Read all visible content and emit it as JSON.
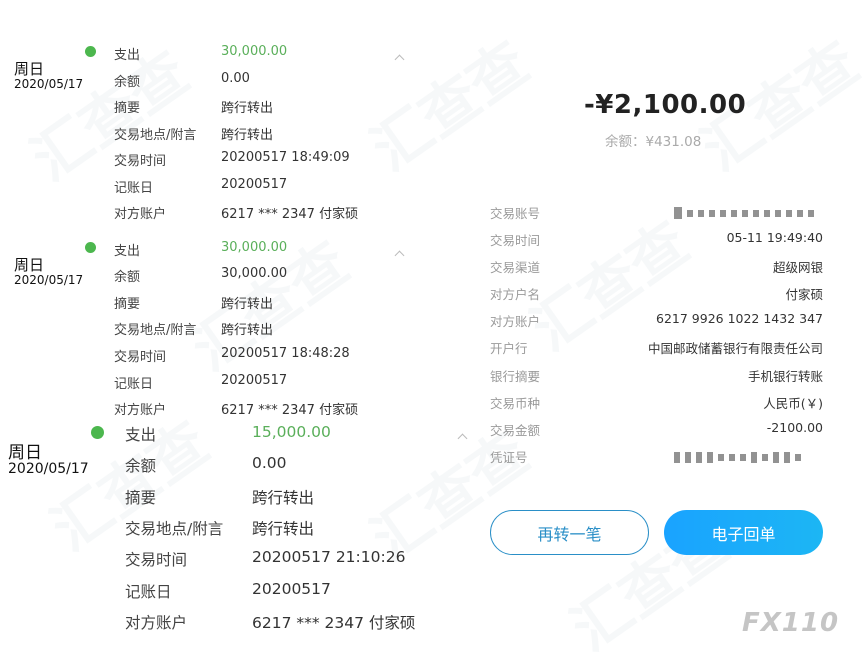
{
  "watermark": "汇查查",
  "left": {
    "records": [
      {
        "day": "周日",
        "date": "2020/05/17",
        "rows": [
          {
            "label": "支出",
            "value": "30,000.00"
          },
          {
            "label": "余额",
            "value": "0.00"
          },
          {
            "label": "摘要",
            "value": "跨行转出"
          },
          {
            "label": "交易地点/附言",
            "value": "跨行转出"
          },
          {
            "label": "交易时间",
            "value": "20200517 18:49:09"
          },
          {
            "label": "记账日",
            "value": "20200517"
          },
          {
            "label": "对方账户",
            "value": "6217 *** 2347 付家硕"
          }
        ]
      },
      {
        "day": "周日",
        "date": "2020/05/17",
        "rows": [
          {
            "label": "支出",
            "value": "30,000.00"
          },
          {
            "label": "余额",
            "value": "30,000.00"
          },
          {
            "label": "摘要",
            "value": "跨行转出"
          },
          {
            "label": "交易地点/附言",
            "value": "跨行转出"
          },
          {
            "label": "交易时间",
            "value": "20200517 18:48:28"
          },
          {
            "label": "记账日",
            "value": "20200517"
          },
          {
            "label": "对方账户",
            "value": "6217 *** 2347 付家硕"
          }
        ]
      },
      {
        "day": "周日",
        "date": "2020/05/17",
        "rows": [
          {
            "label": "支出",
            "value": "15,000.00"
          },
          {
            "label": "余额",
            "value": "0.00"
          },
          {
            "label": "摘要",
            "value": "跨行转出"
          },
          {
            "label": "交易地点/附言",
            "value": "跨行转出"
          },
          {
            "label": "交易时间",
            "value": "20200517 21:10:26"
          },
          {
            "label": "记账日",
            "value": "20200517"
          },
          {
            "label": "对方账户",
            "value": "6217 *** 2347 付家硕"
          }
        ]
      }
    ]
  },
  "right": {
    "amount": "-¥2,100.00",
    "balance": "余额：¥431.08",
    "details": [
      {
        "label": "交易账号",
        "value": ""
      },
      {
        "label": "交易时间",
        "value": "05-11 19:49:40"
      },
      {
        "label": "交易渠道",
        "value": "超级网银"
      },
      {
        "label": "对方户名",
        "value": "付家硕"
      },
      {
        "label": "对方账户",
        "value": "6217 9926 1022 1432 347"
      },
      {
        "label": "开户行",
        "value": "中国邮政储蓄银行有限责任公司"
      },
      {
        "label": "银行摘要",
        "value": "手机银行转账"
      },
      {
        "label": "交易币种",
        "value": "人民币(￥)"
      },
      {
        "label": "交易金额",
        "value": "-2100.00"
      },
      {
        "label": "凭证号",
        "value": ""
      }
    ],
    "buttons": {
      "again": "再转一笔",
      "receipt": "电子回单"
    }
  },
  "corner_logo": "FX110",
  "colors": {
    "green": "#4cb74e",
    "blue": "#1aa3ff",
    "outline": "#2a8fc7"
  }
}
